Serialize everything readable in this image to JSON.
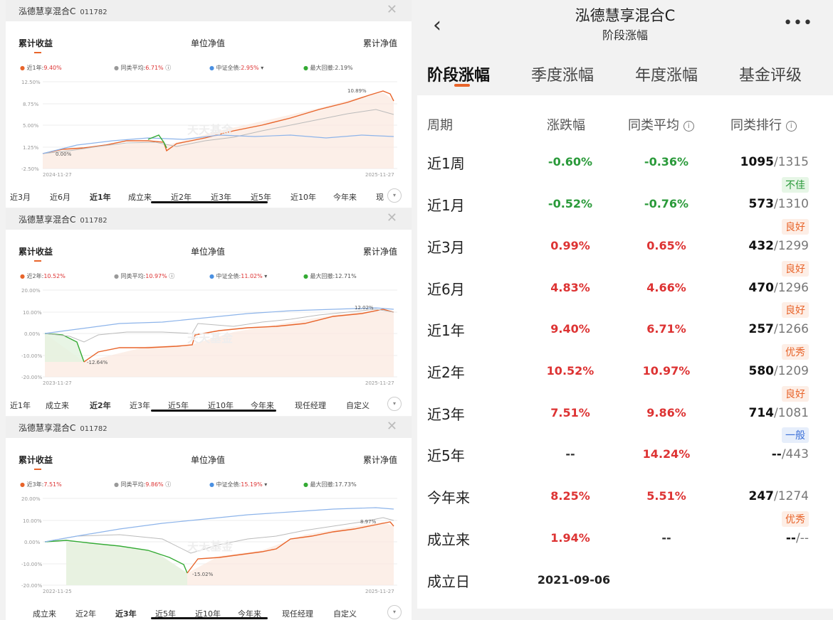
{
  "panels": [
    {
      "title": "泓德慧享混合C",
      "code": "011782",
      "tabs": [
        "累计收益",
        "单位净值",
        "累计净值"
      ],
      "legend": {
        "main_label": "近1年:",
        "main_val": "9.40%",
        "avg_label": "同类平均:",
        "avg_val": "6.71%",
        "idx_label": "中证全债:",
        "idx_val": "2.95%",
        "dd_label": "最大回撤:",
        "dd_val": "2.19%"
      },
      "yticks": [
        "12.50%",
        "8.75%",
        "5.00%",
        "1.25%",
        "-2.50%"
      ],
      "dates": [
        "2024-11-27",
        "2025-11-27"
      ],
      "annot": [
        "10.89%",
        "0.00%"
      ],
      "periods": [
        "近3月",
        "近6月",
        "近1年",
        "成立来",
        "近2年",
        "近3年",
        "近5年",
        "近10年",
        "今年来",
        "现"
      ],
      "selected": 2
    },
    {
      "title": "泓德慧享混合C",
      "code": "011782",
      "tabs": [
        "累计收益",
        "单位净值",
        "累计净值"
      ],
      "legend": {
        "main_label": "近2年:",
        "main_val": "10.52%",
        "avg_label": "同类平均:",
        "avg_val": "10.97%",
        "idx_label": "中证全债:",
        "idx_val": "11.02%",
        "dd_label": "最大回撤:",
        "dd_val": "12.71%"
      },
      "yticks": [
        "20.00%",
        "10.00%",
        "0.00%",
        "-10.00%",
        "-20.00%"
      ],
      "dates": [
        "2023-11-27",
        "2025-11-27"
      ],
      "annot": [
        "12.02%",
        "-12.64%"
      ],
      "periods": [
        "近1年",
        "成立来",
        "近2年",
        "近3年",
        "近5年",
        "近10年",
        "今年来",
        "现任经理",
        "自定义"
      ],
      "selected": 2
    },
    {
      "title": "泓德慧享混合C",
      "code": "011782",
      "tabs": [
        "累计收益",
        "单位净值",
        "累计净值"
      ],
      "legend": {
        "main_label": "近3年:",
        "main_val": "7.51%",
        "avg_label": "同类平均:",
        "avg_val": "9.86%",
        "idx_label": "中证全债:",
        "idx_val": "15.19%",
        "dd_label": "最大回撤:",
        "dd_val": "17.73%"
      },
      "yticks": [
        "20.00%",
        "10.00%",
        "0.00%",
        "-10.00%",
        "-20.00%"
      ],
      "dates": [
        "2022-11-25",
        "2025-11-27"
      ],
      "annot": [
        "8.97%",
        "-15.02%"
      ],
      "periods": [
        "成立来",
        "近2年",
        "近3年",
        "近5年",
        "近10年",
        "今年来",
        "现任经理",
        "自定义"
      ],
      "selected": 2
    }
  ],
  "watermark": "天天基金",
  "right": {
    "title": "泓德慧享混合C",
    "subtitle": "阶段涨幅",
    "tabs": [
      "阶段涨幅",
      "季度涨幅",
      "年度涨幅",
      "基金评级"
    ],
    "headers": [
      "周期",
      "涨跌幅",
      "同类平均",
      "同类排行"
    ],
    "rows": [
      {
        "period": "近1周",
        "chg": "-0.60%",
        "avg": "-0.36%",
        "rank": "1095",
        "total": "/1315",
        "tag": ""
      },
      {
        "period": "近1月",
        "chg": "-0.52%",
        "avg": "-0.76%",
        "rank": "573",
        "total": "/1310",
        "tag": "不佳"
      },
      {
        "period": "近3月",
        "chg": "0.99%",
        "avg": "0.65%",
        "rank": "432",
        "total": "/1299",
        "tag": "良好"
      },
      {
        "period": "近6月",
        "chg": "4.83%",
        "avg": "4.66%",
        "rank": "470",
        "total": "/1296",
        "tag": "良好"
      },
      {
        "period": "近1年",
        "chg": "9.40%",
        "avg": "6.71%",
        "rank": "257",
        "total": "/1266",
        "tag": "良好"
      },
      {
        "period": "近2年",
        "chg": "10.52%",
        "avg": "10.97%",
        "rank": "580",
        "total": "/1209",
        "tag": "优秀"
      },
      {
        "period": "近3年",
        "chg": "7.51%",
        "avg": "9.86%",
        "rank": "714",
        "total": "/1081",
        "tag": "良好"
      },
      {
        "period": "近5年",
        "chg": "--",
        "avg": "14.24%",
        "rank": "--",
        "total": "/443",
        "tag": "一般"
      },
      {
        "period": "今年来",
        "chg": "8.25%",
        "avg": "5.51%",
        "rank": "247",
        "total": "/1274",
        "tag": ""
      },
      {
        "period": "成立来",
        "chg": "1.94%",
        "avg": "--",
        "rank": "--",
        "total": "/--",
        "tag": "优秀"
      },
      {
        "period": "成立日",
        "chg": "2021-09-06",
        "avg": "",
        "rank": "",
        "total": "",
        "tag": ""
      }
    ],
    "colors": {
      "up": "#d33",
      "down": "#2a9a3a",
      "accent": "#e8642a"
    }
  }
}
